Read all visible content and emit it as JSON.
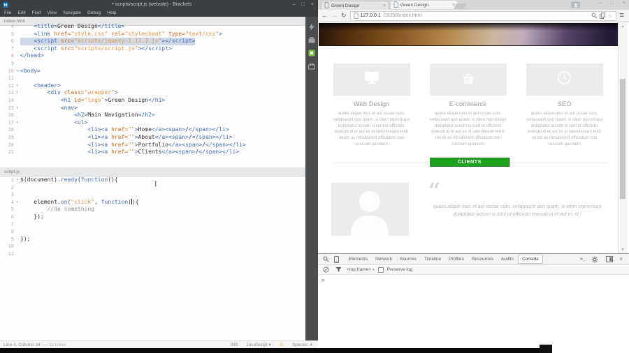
{
  "icons": {
    "fold": "▾",
    "dropdown": "▾",
    "warning": "⚠",
    "back": "←",
    "forward": "→",
    "refresh": "↻",
    "star": "☆",
    "menu": "≡",
    "scroll_up": "▲",
    "scroll_down": "▼",
    "quote": "“",
    "minimize": "–",
    "maximize": "□",
    "close": "×",
    "tab_close": "×",
    "prompt": ">",
    "console_drawer": ">_",
    "ibeam": "I"
  },
  "colors": {
    "accent_green": "#1ea321",
    "highlight_line": "#cfd8e6",
    "tag": "#446fbd",
    "attr": "#c9691c",
    "string": "#e8913f",
    "keyword": "#446fbd",
    "comment": "#949494"
  },
  "brackets": {
    "titlebar": {
      "title": "• scripts/script.js (website) - Brackets"
    },
    "menu": [
      "File",
      "Edit",
      "Find",
      "View",
      "Navigate",
      "Debug",
      "Help"
    ],
    "statusbar": {
      "position": "Line 4, Column 34",
      "lines_info": "— 11 Lines",
      "ins": "INS",
      "language": "JavaScript",
      "spaces": "Spaces: 4"
    },
    "panes": [
      {
        "file": "index.html",
        "lines": [
          {
            "n": 4,
            "tok": [
              [
                "p",
                "    "
              ],
              [
                "t",
                "<title>"
              ],
              [
                "p",
                "Green Design"
              ],
              [
                "t",
                "</title>"
              ]
            ]
          },
          {
            "n": 5,
            "tok": [
              [
                "p",
                "    "
              ],
              [
                "t",
                "<link"
              ],
              [
                "p",
                " "
              ],
              [
                "a",
                "href="
              ],
              [
                "s",
                "\"style.css\""
              ],
              [
                "p",
                " "
              ],
              [
                "a",
                "rel="
              ],
              [
                "s",
                "\"stylesheet\""
              ],
              [
                "p",
                " "
              ],
              [
                "a",
                "type="
              ],
              [
                "s",
                "\"text/css\""
              ],
              [
                "t",
                ">"
              ]
            ]
          },
          {
            "n": 6,
            "hl": true,
            "tok": [
              [
                "p",
                "    "
              ],
              [
                "t",
                "<script"
              ],
              [
                "p",
                " "
              ],
              [
                "a",
                "src="
              ],
              [
                "s",
                "\"scripts/jquery-1.11.3.js\""
              ],
              [
                "t",
                "></script>"
              ]
            ]
          },
          {
            "n": 7,
            "tok": [
              [
                "p",
                "    "
              ],
              [
                "t",
                "<script"
              ],
              [
                "p",
                " "
              ],
              [
                "a",
                "src="
              ],
              [
                "s",
                "\"scripts/script.js\""
              ],
              [
                "t",
                "></script>"
              ]
            ]
          },
          {
            "n": 8,
            "tok": [
              [
                "t",
                "</head>"
              ]
            ]
          },
          {
            "n": 9,
            "tok": []
          },
          {
            "n": 10,
            "fold": true,
            "tok": [
              [
                "t",
                "<body>"
              ]
            ]
          },
          {
            "n": 11,
            "tok": []
          },
          {
            "n": 12,
            "fold": true,
            "tok": [
              [
                "p",
                "    "
              ],
              [
                "t",
                "<header>"
              ]
            ]
          },
          {
            "n": 13,
            "fold": true,
            "tok": [
              [
                "p",
                "        "
              ],
              [
                "t",
                "<div"
              ],
              [
                "p",
                " "
              ],
              [
                "a",
                "class="
              ],
              [
                "s",
                "\"wrapper\""
              ],
              [
                "t",
                ">"
              ]
            ]
          },
          {
            "n": 14,
            "tok": [
              [
                "p",
                "            "
              ],
              [
                "t",
                "<h1"
              ],
              [
                "p",
                " "
              ],
              [
                "a",
                "id="
              ],
              [
                "s",
                "\"logo\""
              ],
              [
                "t",
                ">"
              ],
              [
                "p",
                "Green Design"
              ],
              [
                "t",
                "</h1>"
              ]
            ]
          },
          {
            "n": 15,
            "fold": true,
            "tok": [
              [
                "p",
                "            "
              ],
              [
                "t",
                "<nav>"
              ]
            ]
          },
          {
            "n": 16,
            "tok": [
              [
                "p",
                "                "
              ],
              [
                "t",
                "<h2>"
              ],
              [
                "p",
                "Main Navigation"
              ],
              [
                "t",
                "</h2>"
              ]
            ]
          },
          {
            "n": 17,
            "fold": true,
            "tok": [
              [
                "p",
                "                "
              ],
              [
                "t",
                "<ul>"
              ]
            ]
          },
          {
            "n": 18,
            "tok": [
              [
                "p",
                "                    "
              ],
              [
                "t",
                "<li><a"
              ],
              [
                "p",
                " "
              ],
              [
                "a",
                "href="
              ],
              [
                "s",
                "\"\""
              ],
              [
                "t",
                ">"
              ],
              [
                "p",
                "Home"
              ],
              [
                "t",
                "</a><span>"
              ],
              [
                "p",
                "/"
              ],
              [
                "t",
                "</span></li>"
              ]
            ]
          },
          {
            "n": 19,
            "tok": [
              [
                "p",
                "                    "
              ],
              [
                "t",
                "<li><a"
              ],
              [
                "p",
                " "
              ],
              [
                "a",
                "href="
              ],
              [
                "s",
                "\"\""
              ],
              [
                "t",
                ">"
              ],
              [
                "p",
                "About"
              ],
              [
                "t",
                "</a><span>"
              ],
              [
                "p",
                "/"
              ],
              [
                "t",
                "</span></li>"
              ]
            ]
          },
          {
            "n": 20,
            "tok": [
              [
                "p",
                "                    "
              ],
              [
                "t",
                "<li><a"
              ],
              [
                "p",
                " "
              ],
              [
                "a",
                "href="
              ],
              [
                "s",
                "\"\""
              ],
              [
                "t",
                ">"
              ],
              [
                "p",
                "Portfolio"
              ],
              [
                "t",
                "</a><span>"
              ],
              [
                "p",
                "/"
              ],
              [
                "t",
                "</span></li>"
              ]
            ]
          },
          {
            "n": 21,
            "tok": [
              [
                "p",
                "                    "
              ],
              [
                "t",
                "<li><a"
              ],
              [
                "p",
                " "
              ],
              [
                "a",
                "href="
              ],
              [
                "s",
                "\"\""
              ],
              [
                "t",
                ">"
              ],
              [
                "p",
                "Clients"
              ],
              [
                "t",
                "</a><span>"
              ],
              [
                "p",
                "/"
              ],
              [
                "t",
                "</span></li>"
              ]
            ]
          }
        ]
      },
      {
        "file": "script.js",
        "lines": [
          {
            "n": 1,
            "fold": true,
            "tok": [
              [
                "p",
                "$(document)."
              ],
              [
                "k",
                "ready"
              ],
              [
                "p",
                "("
              ],
              [
                "k",
                "function"
              ],
              [
                "p",
                "(){"
              ]
            ]
          },
          {
            "n": 2,
            "tok": []
          },
          {
            "n": 3,
            "tok": []
          },
          {
            "n": 4,
            "fold": true,
            "tok": [
              [
                "p",
                "    element."
              ],
              [
                "k",
                "on"
              ],
              [
                "p",
                "("
              ],
              [
                "s",
                "\"click\""
              ],
              [
                "p",
                ", "
              ],
              [
                "k",
                "function"
              ],
              [
                "p",
                "("
              ],
              [
                "caret",
                ""
              ],
              [
                "p",
                "){"
              ]
            ]
          },
          {
            "n": 5,
            "tok": [
              [
                "p",
                "        "
              ],
              [
                "c",
                "//do something"
              ]
            ]
          },
          {
            "n": 6,
            "tok": [
              [
                "p",
                "    });"
              ]
            ]
          },
          {
            "n": 7,
            "tok": []
          },
          {
            "n": 8,
            "tok": []
          },
          {
            "n": 9,
            "tok": [
              [
                "p",
                "});"
              ]
            ]
          },
          {
            "n": 10,
            "tok": []
          },
          {
            "n": 11,
            "tok": []
          }
        ]
      }
    ]
  },
  "browser": {
    "tabs": [
      {
        "title": "Green Design"
      },
      {
        "title": "Green Design"
      }
    ],
    "active_tab": 1,
    "url_host": "127.0.0.1",
    "url_path": ":59298/index.html"
  },
  "page": {
    "services": {
      "items": [
        {
          "title": "Web Design",
          "icon": "monitor"
        },
        {
          "title": "E-commerce",
          "icon": "basket"
        },
        {
          "title": "SEO",
          "icon": "clock"
        }
      ],
      "paragraph": "quatis alique mos et aut occae cum, veliquaspit quo quam, si idem reprorisqui doluptatur accum si sunt ut officiisto enecab id et aut es et laboribusam endi rerum as minullorent officiatum non cuscium quuntem"
    },
    "clients_label": "CLIENTS",
    "quote_text": "quatis alique mos et aut occae cum, veliquaspit quo quam, si idem reprorisqui doluptatur accum si sunt ut officiisto enecab id et aut es et !"
  },
  "devtools": {
    "tabs": [
      "Elements",
      "Network",
      "Sources",
      "Timeline",
      "Profiles",
      "Resources",
      "Audits",
      "Console"
    ],
    "active_tab": "Console",
    "frame_selector": "<top frame>",
    "preserve_log_label": "Preserve log"
  }
}
